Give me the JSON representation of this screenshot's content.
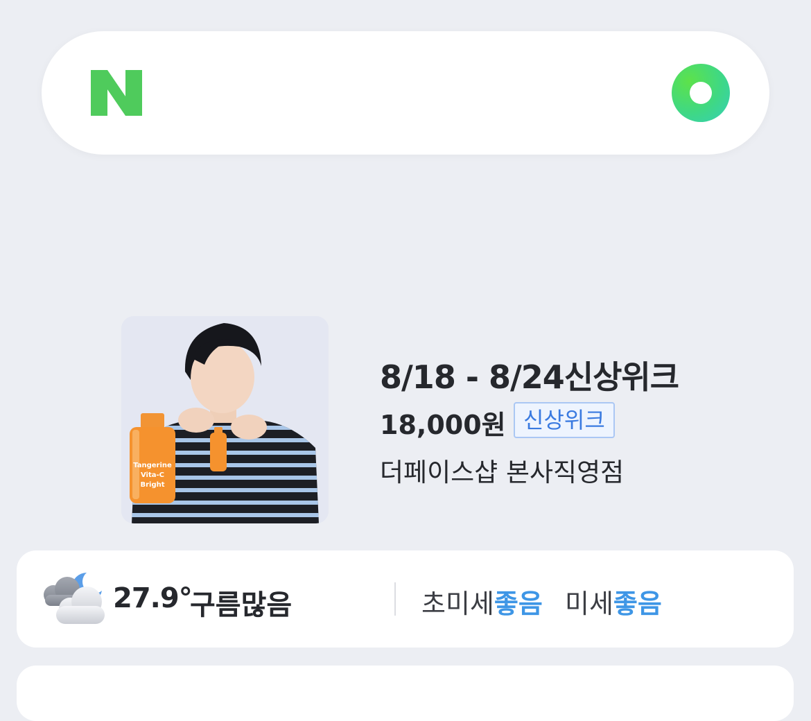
{
  "search": {
    "logo_icon": "naver-n-logo",
    "voice_icon": "green-dot-icon"
  },
  "promo": {
    "title": "8/18 - 8/24신상위크",
    "price": "18,000원",
    "badge": "신상위크",
    "store": "더페이스샵 본사직영점",
    "product_text": [
      "Tangerine",
      "Vita-C",
      "Bright"
    ]
  },
  "weather": {
    "icon": "partly-cloudy-night-icon",
    "temperature": "27.9°",
    "condition": "구름많음",
    "ultrafine_label": "초미세",
    "ultrafine_value": "좋음",
    "fine_label": "미세",
    "fine_value": "좋음"
  },
  "colors": {
    "background": "#eceef3",
    "brand_green": "#4fcb5c",
    "status_blue": "#3e96e6"
  }
}
